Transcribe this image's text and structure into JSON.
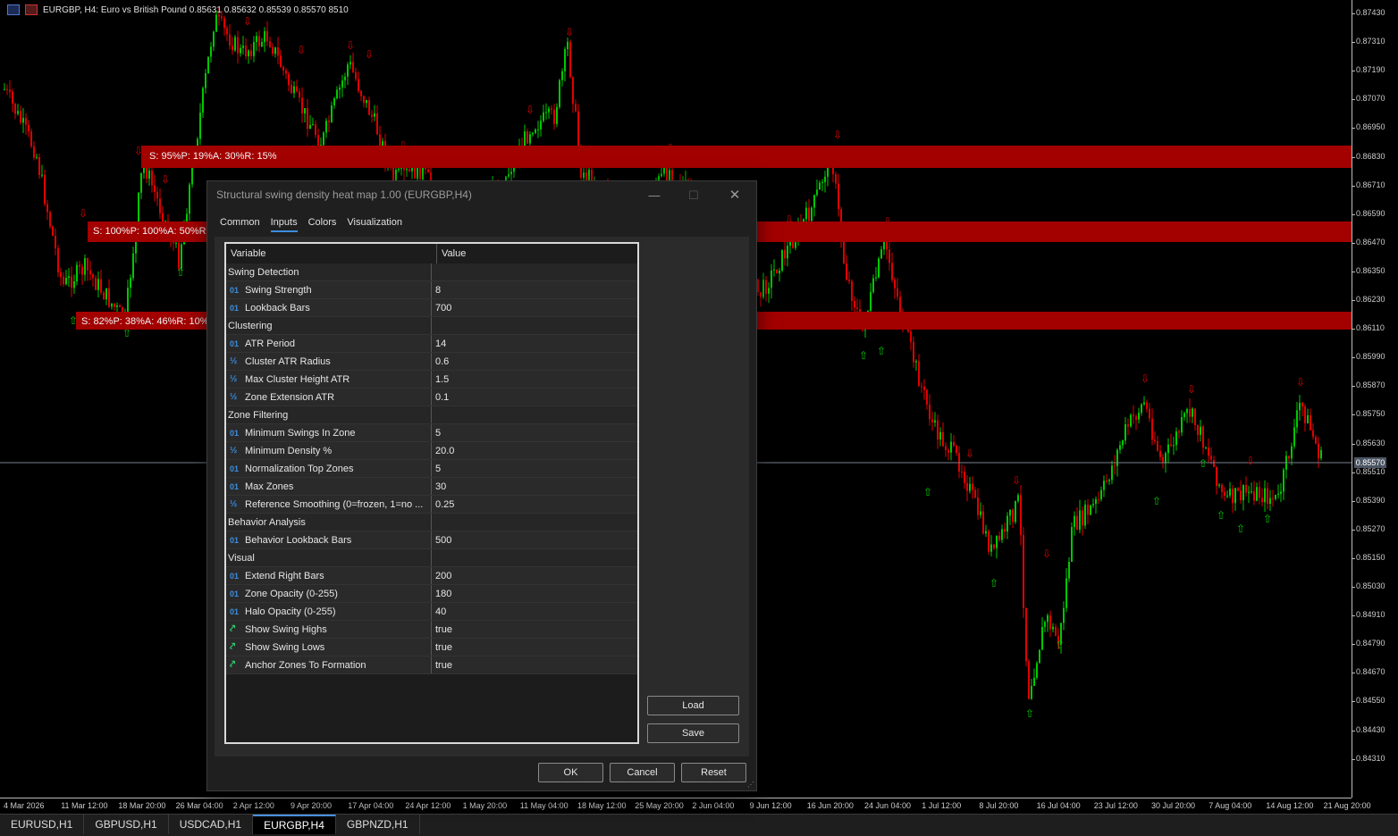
{
  "chart": {
    "header": "EURGBP, H4:  Euro vs British Pound  0.85631 0.85632 0.85539 0.85570  8510",
    "colors": {
      "bull": "#00c800",
      "bear": "#e00000",
      "zone": "#a30000",
      "background": "#000000"
    },
    "zones": [
      {
        "label": "S: 95%P: 19%A: 30%R: 15%"
      },
      {
        "label": "S: 100%P: 100%A: 50%R:"
      },
      {
        "label": "S: 82%P: 38%A: 46%R: 10%"
      }
    ],
    "price_ticks": [
      "0.87430",
      "0.87310",
      "0.87190",
      "0.87070",
      "0.86950",
      "0.86830",
      "0.86710",
      "0.86590",
      "0.86470",
      "0.86350",
      "0.86230",
      "0.86110",
      "0.85990",
      "0.85870",
      "0.85750",
      "0.85630",
      "0.85510",
      "0.85390",
      "0.85270",
      "0.85150",
      "0.85030",
      "0.84910",
      "0.84790",
      "0.84670",
      "0.84550",
      "0.84430",
      "0.84310"
    ],
    "current_price": "0.85570",
    "time_ticks": [
      "4 Mar 2026",
      "11 Mar 12:00",
      "18 Mar 20:00",
      "26 Mar 04:00",
      "2 Apr 12:00",
      "9 Apr 20:00",
      "17 Apr 04:00",
      "24 Apr 12:00",
      "1 May 20:00",
      "11 May 04:00",
      "18 May 12:00",
      "25 May 20:00",
      "2 Jun 04:00",
      "9 Jun 12:00",
      "16 Jun 20:00",
      "24 Jun 04:00",
      "1 Jul 12:00",
      "8 Jul 20:00",
      "16 Jul 04:00",
      "23 Jul 12:00",
      "30 Jul 20:00",
      "7 Aug 04:00",
      "14 Aug 12:00",
      "21 Aug 20:00"
    ]
  },
  "symbol_tabs": [
    {
      "label": "EURUSD,H1",
      "active": false
    },
    {
      "label": "GBPUSD,H1",
      "active": false
    },
    {
      "label": "USDCAD,H1",
      "active": false
    },
    {
      "label": "EURGBP,H4",
      "active": true
    },
    {
      "label": "GBPNZD,H1",
      "active": false
    }
  ],
  "dialog": {
    "title": "Structural swing density heat map 1.00 (EURGBP,H4)",
    "window_buttons": {
      "minimize": "—",
      "maximize": "☐",
      "close": "✕"
    },
    "tabs": [
      "Common",
      "Inputs",
      "Colors",
      "Visualization"
    ],
    "active_tab": "Inputs",
    "grid": {
      "header_variable": "Variable",
      "header_value": "Value",
      "rows": [
        {
          "type": "group",
          "name": "Swing Detection"
        },
        {
          "type": "int",
          "name": "Swing Strength",
          "value": "8"
        },
        {
          "type": "int",
          "name": "Lookback Bars",
          "value": "700"
        },
        {
          "type": "group",
          "name": "Clustering"
        },
        {
          "type": "int",
          "name": "ATR Period",
          "value": "14"
        },
        {
          "type": "double",
          "name": "Cluster ATR Radius",
          "value": "0.6"
        },
        {
          "type": "double",
          "name": "Max Cluster Height ATR",
          "value": "1.5"
        },
        {
          "type": "double",
          "name": "Zone Extension ATR",
          "value": "0.1"
        },
        {
          "type": "group",
          "name": "Zone Filtering"
        },
        {
          "type": "int",
          "name": "Minimum Swings In Zone",
          "value": "5"
        },
        {
          "type": "double",
          "name": "Minimum Density %",
          "value": "20.0"
        },
        {
          "type": "int",
          "name": "Normalization Top Zones",
          "value": "5"
        },
        {
          "type": "int",
          "name": "Max Zones",
          "value": "30"
        },
        {
          "type": "double",
          "name": "Reference Smoothing (0=frozen, 1=no ...",
          "value": "0.25"
        },
        {
          "type": "group",
          "name": "Behavior Analysis"
        },
        {
          "type": "int",
          "name": "Behavior Lookback Bars",
          "value": "500"
        },
        {
          "type": "group",
          "name": "Visual"
        },
        {
          "type": "int",
          "name": "Extend Right Bars",
          "value": "200"
        },
        {
          "type": "int",
          "name": "Zone Opacity (0-255)",
          "value": "180"
        },
        {
          "type": "int",
          "name": "Halo Opacity (0-255)",
          "value": "40"
        },
        {
          "type": "bool",
          "name": "Show Swing Highs",
          "value": "true"
        },
        {
          "type": "bool",
          "name": "Show Swing Lows",
          "value": "true"
        },
        {
          "type": "bool",
          "name": "Anchor Zones To Formation",
          "value": "true"
        }
      ]
    },
    "icons": {
      "int": "01",
      "double": "½",
      "bool": "⤤"
    },
    "buttons": {
      "load": "Load",
      "save": "Save",
      "ok": "OK",
      "cancel": "Cancel",
      "reset": "Reset"
    }
  }
}
